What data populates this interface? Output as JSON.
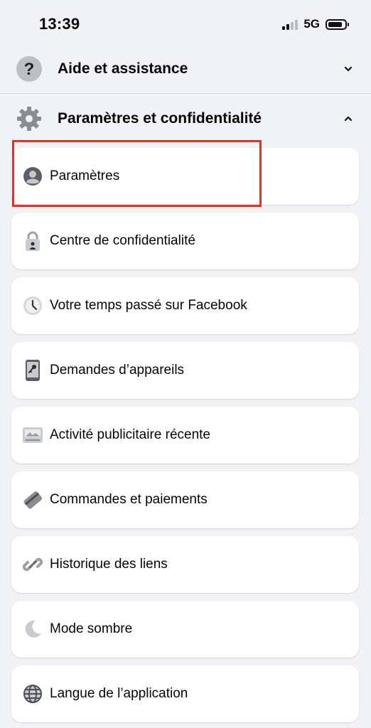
{
  "status_bar": {
    "time": "13:39",
    "network": "5G",
    "battery_level": 0.85
  },
  "sections": {
    "help": {
      "label": "Aide et assistance",
      "icon": "question-icon",
      "expanded": false
    },
    "settings": {
      "label": "Paramètres et confidentialité",
      "icon": "gear-icon",
      "expanded": true
    }
  },
  "menu_items": [
    {
      "label": "Paramètres",
      "icon": "profile-icon",
      "highlighted": true
    },
    {
      "label": "Centre de confidentialité",
      "icon": "lock-icon"
    },
    {
      "label": "Votre temps passé sur Facebook",
      "icon": "clock-icon"
    },
    {
      "label": "Demandes d’appareils",
      "icon": "device-key-icon"
    },
    {
      "label": "Activité publicitaire récente",
      "icon": "ad-image-icon"
    },
    {
      "label": "Commandes et paiements",
      "icon": "card-icon"
    },
    {
      "label": "Historique des liens",
      "icon": "link-icon"
    },
    {
      "label": "Mode sombre",
      "icon": "moon-icon"
    },
    {
      "label": "Langue de l’application",
      "icon": "globe-icon"
    }
  ],
  "colors": {
    "background": "#f0f2f5",
    "card": "#ffffff",
    "highlight": "#e8301c",
    "icon_gray": "#8a8d91"
  }
}
